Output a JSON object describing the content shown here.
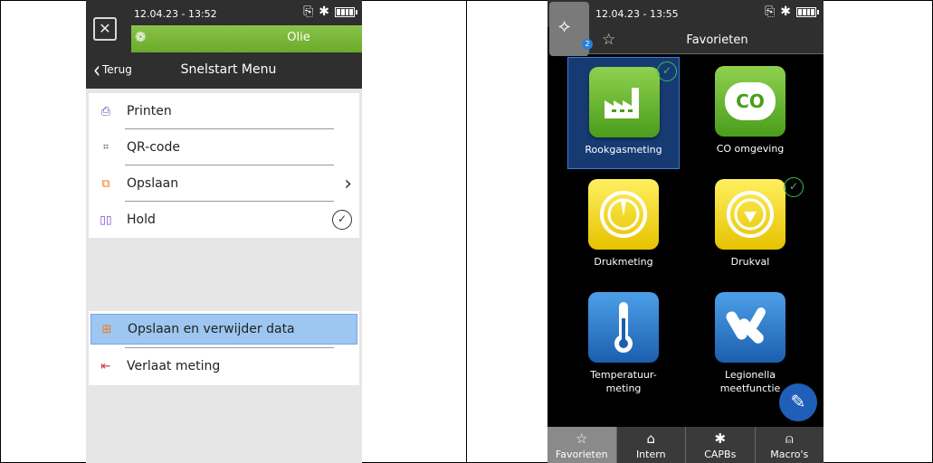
{
  "left": {
    "status": {
      "time": "12.04.23 - 13:52"
    },
    "header": {
      "title": "Olie"
    },
    "nav": {
      "back_label": "Terug",
      "title": "Snelstart Menu"
    },
    "menu": [
      {
        "label": "Printen",
        "icon": "printer-icon"
      },
      {
        "label": "QR-code",
        "icon": "qr-code-icon"
      },
      {
        "label": "Opslaan",
        "icon": "save-icon"
      },
      {
        "label": "Hold",
        "icon": "pause-icon"
      }
    ],
    "menu2": [
      {
        "label": "Opslaan en verwijder data",
        "icon": "save-delete-icon"
      },
      {
        "label": "Verlaat meting",
        "icon": "exit-icon"
      }
    ]
  },
  "right": {
    "status": {
      "time": "12.04.23 - 13:55"
    },
    "share_badge": "2",
    "header": {
      "title": "Favorieten"
    },
    "tiles": [
      {
        "label": "Rookgasmeting",
        "icon": "factory-icon"
      },
      {
        "label": "CO omgeving",
        "icon": "co-cloud-icon",
        "icon_text": "CO"
      },
      {
        "label": "Drukmeting",
        "icon": "pressure-gauge-icon"
      },
      {
        "label": "Drukval",
        "icon": "pressure-drop-icon"
      },
      {
        "label": "Temperatuur-\nmeting",
        "icon": "thermometer-icon"
      },
      {
        "label": "Legionella\nmeetfunctie",
        "icon": "legionella-icon"
      }
    ],
    "tabs": [
      {
        "label": "Favorieten",
        "icon": "star-icon"
      },
      {
        "label": "Intern",
        "icon": "home-icon"
      },
      {
        "label": "CAPBs",
        "icon": "bluetooth-icon"
      },
      {
        "label": "Macro's",
        "icon": "user-icon"
      }
    ]
  },
  "colors": {
    "accent_green": "#6aaa2a",
    "selection_blue": "#9dc6f0",
    "check_green": "#3cbf5c"
  }
}
